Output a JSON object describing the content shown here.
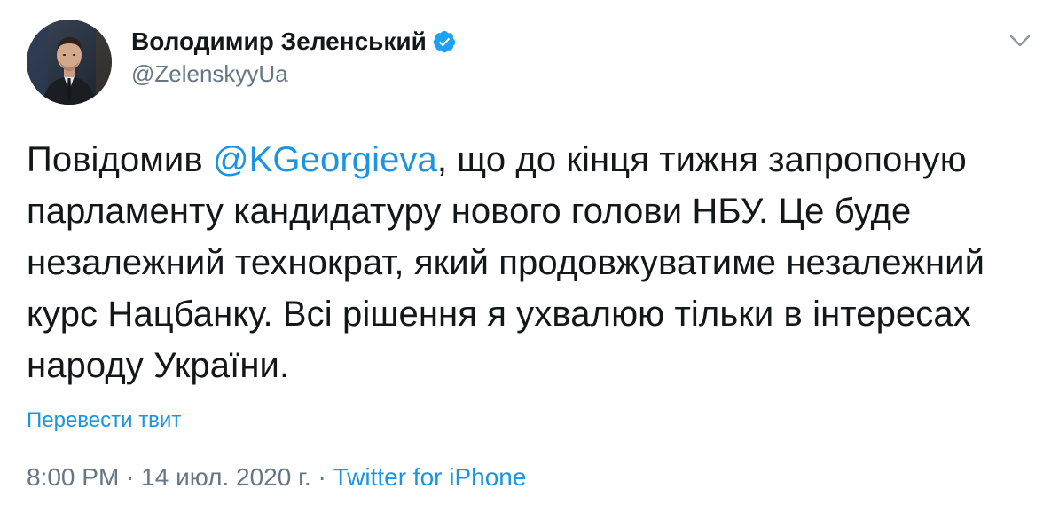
{
  "author": {
    "display_name": "Володимир Зеленський",
    "handle": "@ZelenskyyUa",
    "verified": true,
    "avatar_icon": "profile-photo"
  },
  "tweet": {
    "text_before_mention": "Повідомив ",
    "mention": "@KGeorgieva",
    "text_after_mention": ", що до кінця тижня запропоную парламенту кандидатуру нового голови НБУ. Це буде незалежний технократ, який продовжуватиме незалежний курс Нацбанку. Всі рішення я ухвалюю тільки в інтересах народу України."
  },
  "translate_label": "Перевести твит",
  "meta": {
    "time": "8:00 PM",
    "separator1": " · ",
    "date": "14 июл. 2020 г.",
    "separator2": " · ",
    "source": "Twitter for iPhone"
  },
  "colors": {
    "link": "#1b95e0",
    "secondary_text": "#657786",
    "primary_text": "#14171a",
    "verified_badge": "#1da1f2"
  },
  "icons": {
    "verified": "verified-badge-icon",
    "menu": "chevron-down-icon"
  }
}
